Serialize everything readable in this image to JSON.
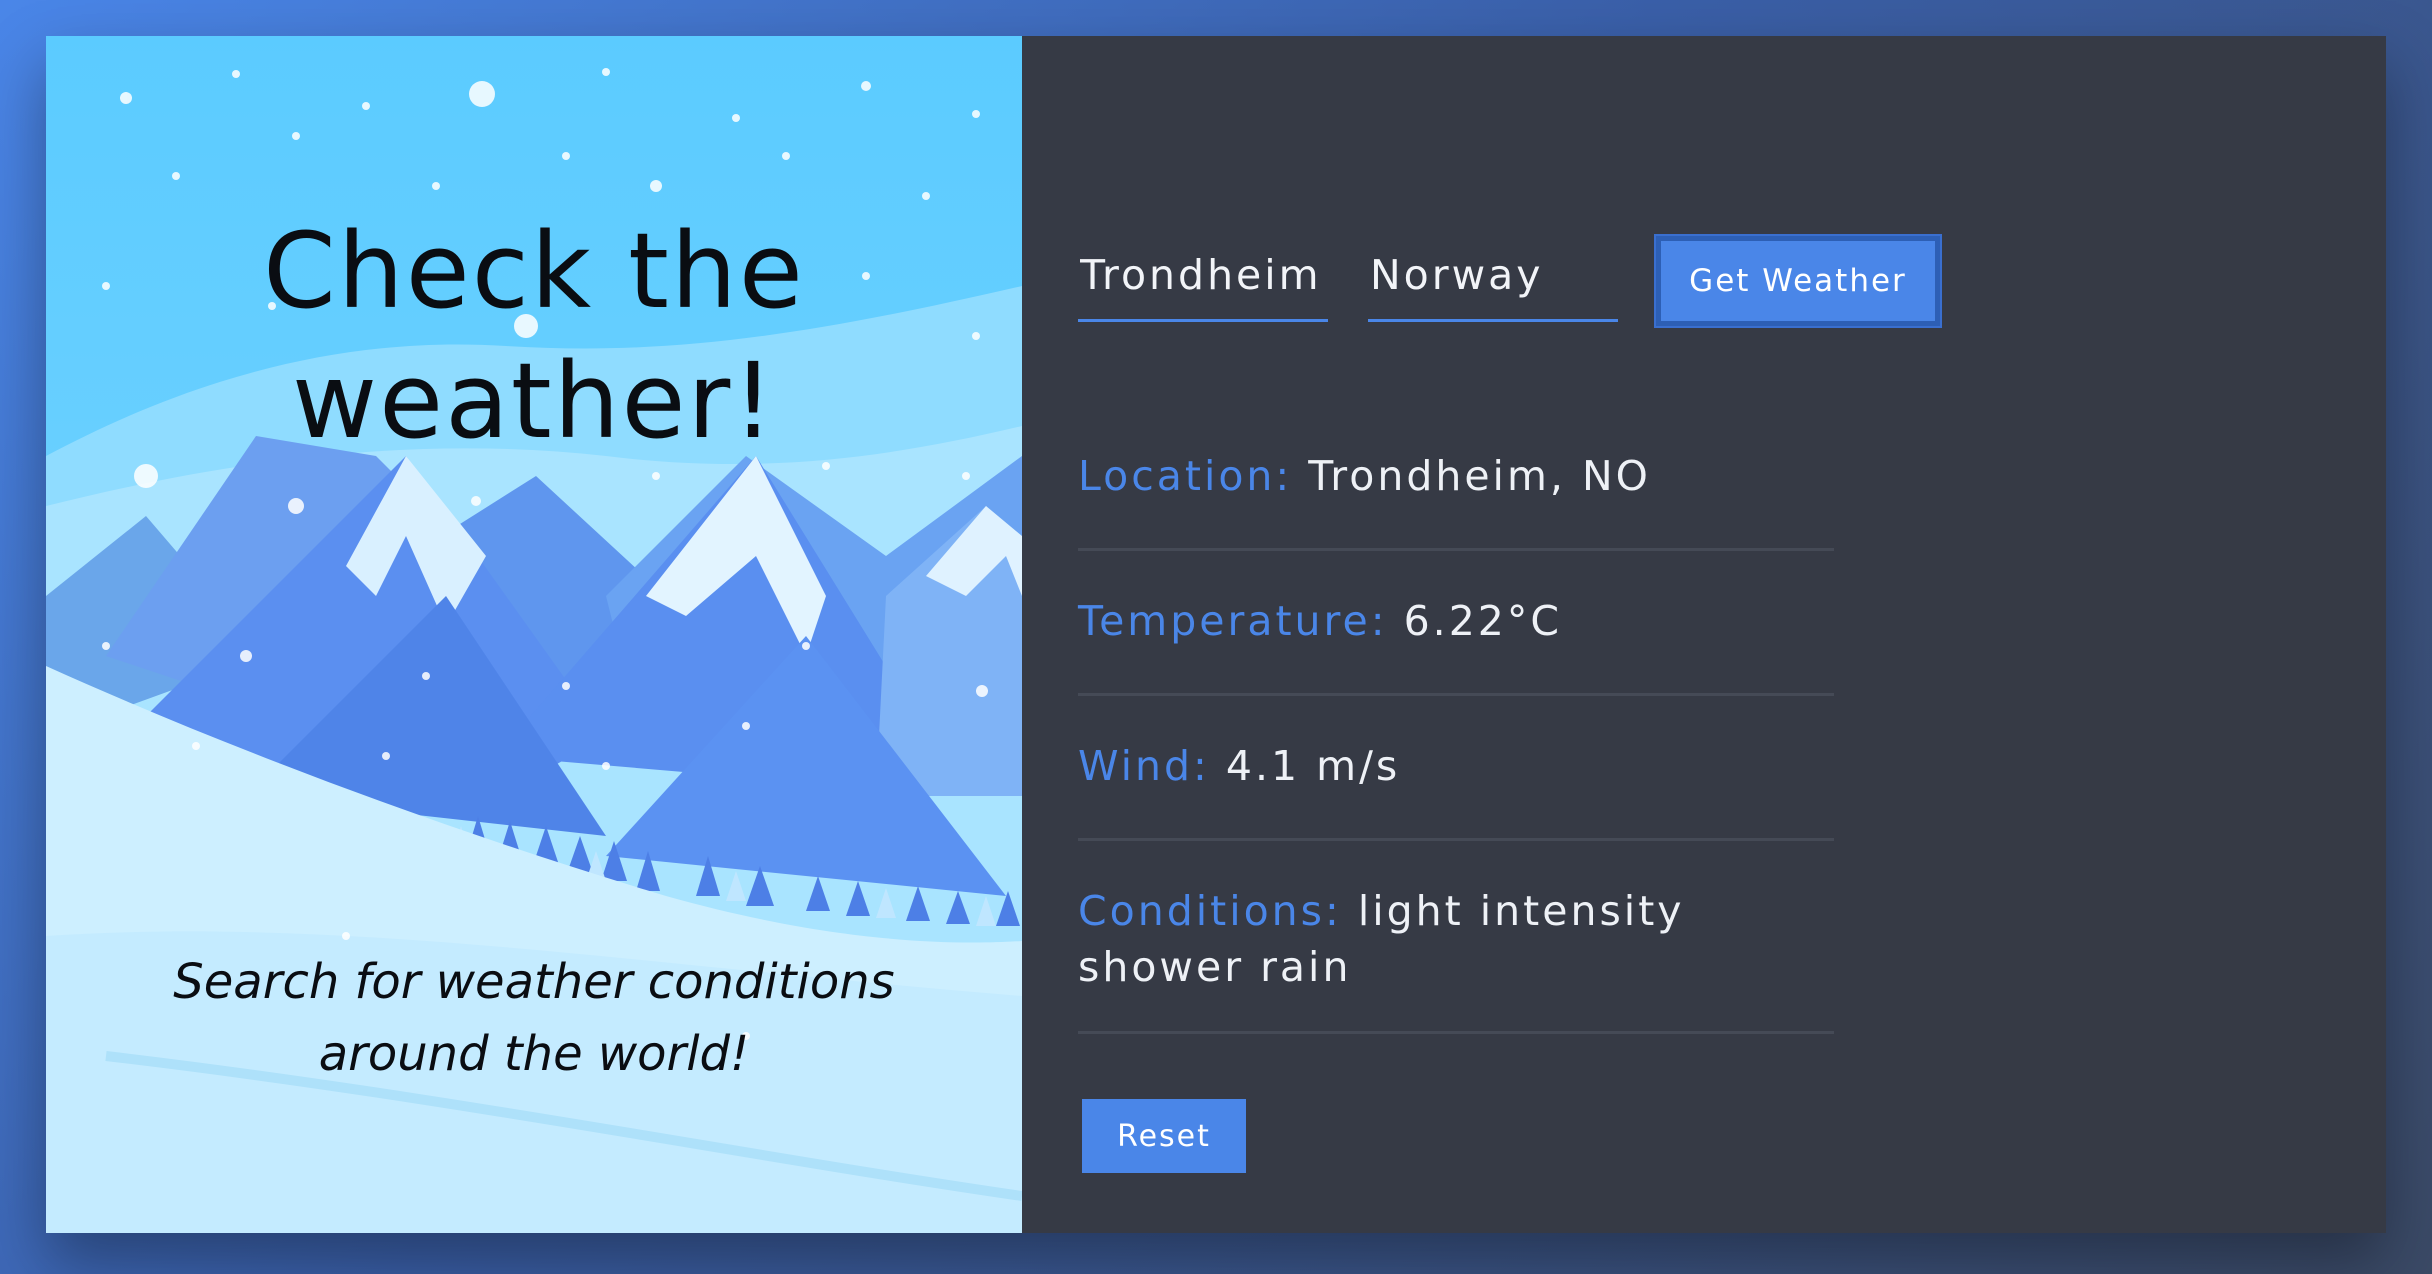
{
  "hero": {
    "title": "Check the weather!",
    "subtitle": "Search for weather conditions around the world!"
  },
  "search": {
    "city_value": "Trondheim",
    "country_value": "Norway",
    "button_label": "Get Weather"
  },
  "results": {
    "location_label": "Location:",
    "location_value": "Trondheim, NO",
    "temperature_label": "Temperature:",
    "temperature_value": "6.22°C",
    "wind_label": "Wind:",
    "wind_value": "4.1 m/s",
    "conditions_label": "Conditions:",
    "conditions_value": "light intensity shower rain"
  },
  "reset_label": "Reset",
  "colors": {
    "accent": "#4a86e8",
    "panel_dark": "#363a45",
    "sky": "#5ccbff"
  }
}
